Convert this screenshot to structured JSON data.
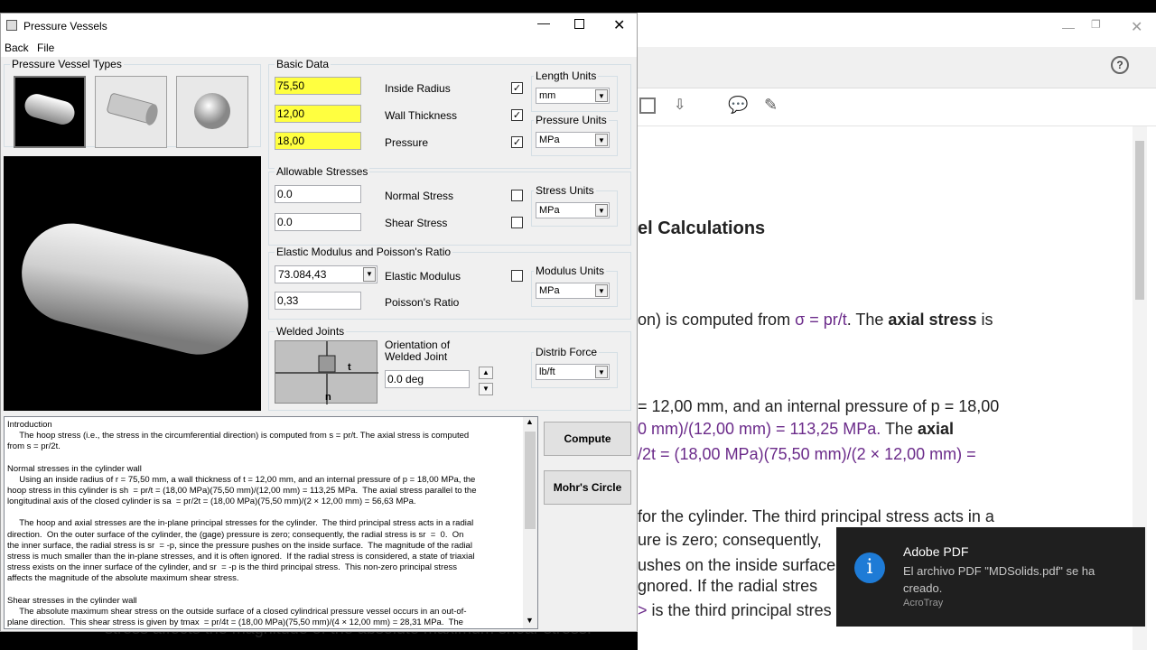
{
  "main_window": {
    "title": "Pressure Vessels",
    "menu": [
      "Back",
      "File"
    ],
    "vessel_types": {
      "legend": "Pressure Vessel Types",
      "items": [
        "cylinder-solid",
        "cylinder-open",
        "sphere"
      ]
    },
    "basic_data": {
      "legend": "Basic Data",
      "inside_radius": {
        "value": "75,50",
        "label": "Inside Radius",
        "checked": true
      },
      "wall_thickness": {
        "value": "12,00",
        "label": "Wall Thickness",
        "checked": true
      },
      "pressure": {
        "value": "18,00",
        "label": "Pressure",
        "checked": true
      },
      "length_units": {
        "legend": "Length Units",
        "value": "mm"
      },
      "pressure_units": {
        "legend": "Pressure Units",
        "value": "MPa"
      }
    },
    "allowable": {
      "legend": "Allowable Stresses",
      "normal": {
        "value": "0.0",
        "label": "Normal Stress",
        "checked": false
      },
      "shear": {
        "value": "0.0",
        "label": "Shear Stress",
        "checked": false
      },
      "stress_units": {
        "legend": "Stress Units",
        "value": "MPa"
      }
    },
    "elastic": {
      "legend": "Elastic Modulus and Poisson's Ratio",
      "modulus": {
        "value": "73.084,43",
        "label": "Elastic Modulus",
        "checked": false
      },
      "poisson": {
        "value": "0,33",
        "label": "Poisson's Ratio"
      },
      "modulus_units": {
        "legend": "Modulus Units",
        "value": "MPa"
      }
    },
    "welded": {
      "legend": "Welded Joints",
      "orientation_label_1": "Orientation of",
      "orientation_label_2": "Welded Joint",
      "angle": "0.0 deg",
      "axis_t": "t",
      "axis_n": "n",
      "distrib_force": {
        "legend": "Distrib Force",
        "value": "lb/ft"
      }
    },
    "buttons": {
      "compute": "Compute",
      "mohr": "Mohr's Circle"
    },
    "results_text": {
      "p1": "Introduction",
      "p2": "     The hoop stress (i.e., the stress in the circumferential direction) is computed from s = pr/t. The axial stress is computed\nfrom s = pr/2t.",
      "p3": "Normal stresses in the cylinder wall",
      "p4": "     Using an inside radius of r = 75,50 mm, a wall thickness of t = 12,00 mm, and an internal pressure of p = 18,00 MPa, the\nhoop stress in this cylinder is sh  = pr/t = (18,00 MPa)(75,50 mm)/(12,00 mm) = 113,25 MPa.  The axial stress parallel to the\nlongitudinal axis of the closed cylinder is sa  = pr/2t = (18,00 MPa)(75,50 mm)/(2 × 12,00 mm) = 56,63 MPa.",
      "p5": "     The hoop and axial stresses are the in-plane principal stresses for the cylinder.  The third principal stress acts in a radial\ndirection.  On the outer surface of the cylinder, the (gage) pressure is zero; consequently, the radial stress is sr  =  0.  On\nthe inner surface, the radial stress is sr  = -p, since the pressure pushes on the inside surface.  The magnitude of the radial\nstress is much smaller than the in-plane stresses, and it is often ignored.  If the radial stress is considered, a state of triaxial\nstress exists on the inner surface of the cylinder, and sr  = -p is the third principal stress.  This non-zero principal stress\naffects the magnitude of the absolute maximum shear stress.",
      "p6": "Shear stresses in the cylinder wall",
      "p7": "     The absolute maximum shear stress on the outside surface of a closed cylindrical pressure vessel occurs in an out-of-\nplane direction.  This shear stress is given by tmax  = pr/4t = (18,00 MPa)(75,50 mm)/(4 × 12,00 mm) = 28,31 MPa.  The"
    }
  },
  "background_pdf": {
    "heading": "el Calculations",
    "line1a": "on) is computed from ",
    "line1b": "σ = pr/t",
    "line1c": ". The ",
    "line1d": "axial stress",
    "line1e": " is",
    "line2": "= 12,00 mm, and an internal pressure of p = 18,00",
    "line3a": "0 mm)/(12,00 mm) = 113,25 MPa.",
    "line3b": "  The ",
    "line3c": "axial",
    "line4": "/2t = (18,00 MPa)(75,50 mm)/(2 × 12,00 mm) =",
    "line5": " for the cylinder.  The third principal stress acts in a",
    "line6": "ure is zero; consequently, ",
    "line7": "ushes on the inside surface",
    "line8": "gnored.  If the radial stres",
    "line9a": "> ",
    "line9b": "is the third principal stres",
    "line10": "stress affects the magnitude of the absolute maximum shear stress."
  },
  "toast": {
    "app": "Adobe PDF",
    "message": "El archivo PDF \"MDSolids.pdf\" se ha creado.",
    "source": "AcroTray"
  }
}
